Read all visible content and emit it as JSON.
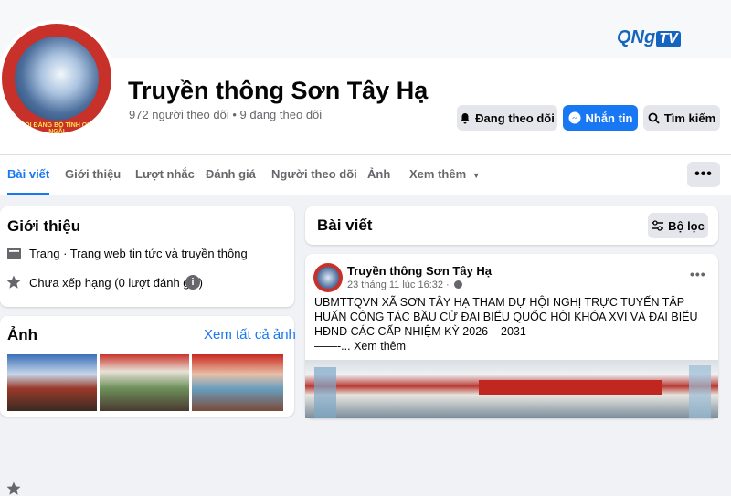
{
  "page": {
    "title": "Truyền thông Sơn Tây Hạ",
    "stats": "972 người theo dõi • 9 đang theo dõi",
    "avatar_caption": "ĐẠI HỘI ĐẢNG BỘ TỈNH QUẢNG NGÃI"
  },
  "channel_logo": {
    "qng": "QNg",
    "tv": "TV"
  },
  "actions": {
    "following": "Đang theo dõi",
    "message": "Nhắn tin",
    "search": "Tìm kiếm"
  },
  "tabs": [
    {
      "label": "Bài viết",
      "active": true
    },
    {
      "label": "Giới thiệu"
    },
    {
      "label": "Lượt nhắc"
    },
    {
      "label": "Đánh giá"
    },
    {
      "label": "Người theo dõi"
    },
    {
      "label": "Ảnh"
    },
    {
      "label": "Xem thêm"
    }
  ],
  "more_label": "•••",
  "intro": {
    "title": "Giới thiệu",
    "category": "Trang · Trang web tin tức và truyền thông",
    "rating": "Chưa xếp hạng (0 lượt đánh giá)"
  },
  "photos": {
    "title": "Ảnh",
    "see_all": "Xem tất cả ảnh"
  },
  "posts_section": {
    "title": "Bài viết",
    "filter": "Bộ lọc"
  },
  "post": {
    "author": "Truyền thông Sơn Tây Hạ",
    "time": "23 tháng 11 lúc 16:32 ·",
    "text": "UBMTTQVN XÃ SƠN TÂY HẠ THAM DỰ HỘI NGHỊ TRỰC TUYẾN TẬP HUẤN CÔNG TÁC BẦU CỬ ĐẠI BIỂU QUỐC HỘI KHÓA XVI VÀ ĐẠI BIỂU HĐND CÁC CẤP NHIỆM KỲ 2026 – 2031",
    "dash": "——-...",
    "see_more": "Xem thêm",
    "options": "•••"
  },
  "colors": {
    "accent": "#1877f2",
    "background": "#f0f2f5",
    "muted_text": "#65676b",
    "button_grey": "#e4e6eb"
  }
}
